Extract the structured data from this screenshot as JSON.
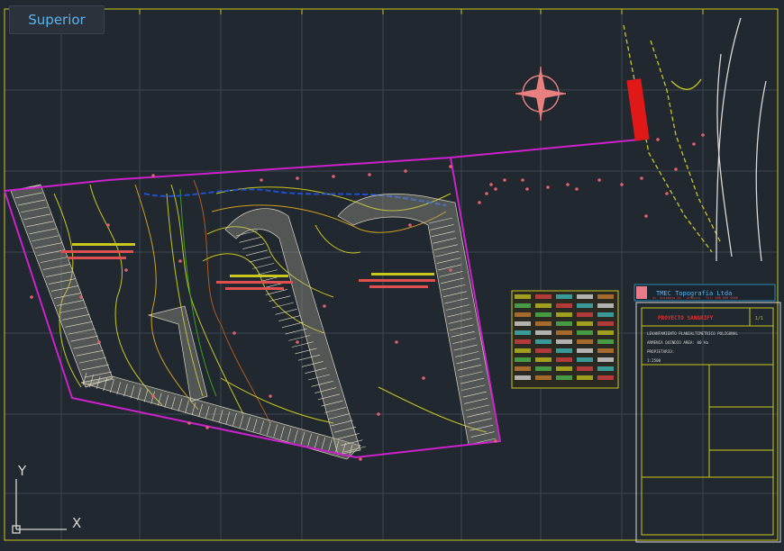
{
  "view_label": "Superior",
  "ucs": {
    "y_label": "Y",
    "x_label": "X"
  },
  "title_block": {
    "company": "TMEC Topografía Ltda",
    "company_sub": "Av. Quimbaya 54 - Armenia · Tel: 000 000 0000",
    "project": "PROYECTO SANGRIFY",
    "lines": [
      "LEVANTAMIENTO PLANIALTIMETRICO POLIGONAL",
      "ARMENIA QUINDIO AREA: 00 Ha",
      "PROPIETARIO:"
    ],
    "label_short": "1:2500",
    "sheet": "1/1"
  },
  "colors": {
    "background": "#212830",
    "grid": "#3d4650",
    "frame": "#c8c81e",
    "boundary": "#cc22cc",
    "badge_text": "#5ab4ee"
  }
}
